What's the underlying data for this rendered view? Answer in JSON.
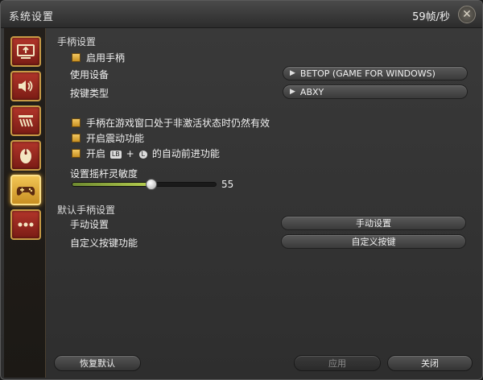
{
  "window": {
    "title": "系统设置",
    "fps": "59帧/秒"
  },
  "sidebar": {
    "items": [
      {
        "name": "display",
        "icon": "monitor-icon"
      },
      {
        "name": "sound",
        "icon": "speaker-icon"
      },
      {
        "name": "hud",
        "icon": "bars-icon"
      },
      {
        "name": "mouse",
        "icon": "mouse-icon"
      },
      {
        "name": "gamepad",
        "icon": "gamepad-icon",
        "active": true
      },
      {
        "name": "other",
        "icon": "more-icon"
      }
    ]
  },
  "gamepad": {
    "section_title": "手柄设置",
    "enable_label": "启用手柄",
    "enable_checked": true,
    "device_label": "使用设备",
    "device_value": "BETOP (GAME FOR WINDOWS)",
    "button_type_label": "按键类型",
    "button_type_value": "ABXY",
    "inactive_window_label": "手柄在游戏窗口处于非激活状态时仍然有效",
    "inactive_window_checked": true,
    "vibration_label": "开启震动功能",
    "vibration_checked": true,
    "autorun_prefix": "开启",
    "autorun_key1": "LB",
    "autorun_plus": "+",
    "autorun_key2": "L",
    "autorun_suffix": "的自动前进功能",
    "autorun_checked": true,
    "sensitivity_label": "设置摇杆灵敏度",
    "sensitivity_value": "55",
    "sensitivity_fraction": 0.55
  },
  "defaults": {
    "section_title": "默认手柄设置",
    "manual_label": "手动设置",
    "manual_button": "手动设置",
    "custom_label": "自定义按键功能",
    "custom_button": "自定义按键"
  },
  "footer": {
    "reset_button": "恢复默认",
    "apply_button": "应用",
    "close_button": "关闭"
  },
  "colors": {
    "accent_gold": "#c79a45",
    "sidebar_red": "#b2352a",
    "slider_green": "#b8d050"
  }
}
